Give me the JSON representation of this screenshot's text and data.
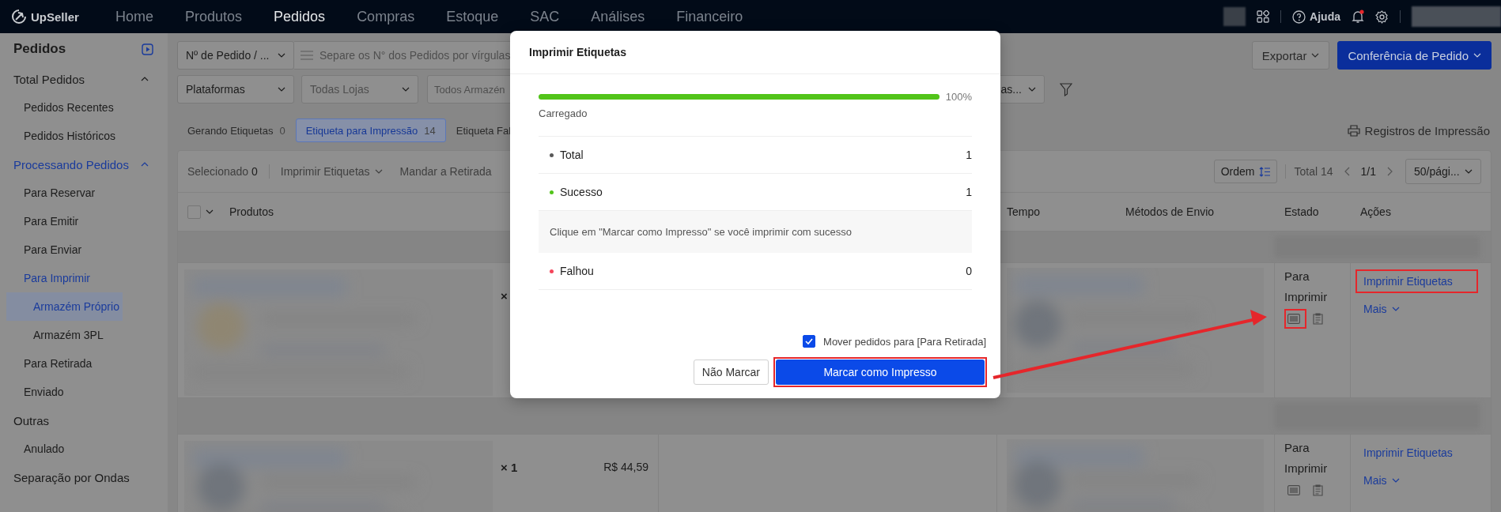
{
  "top_nav": {
    "logo": "UpSeller",
    "items": [
      {
        "label": "Home",
        "selected": false
      },
      {
        "label": "Produtos",
        "selected": false
      },
      {
        "label": "Pedidos",
        "selected": true
      },
      {
        "label": "Compras",
        "selected": false
      },
      {
        "label": "Estoque",
        "selected": false
      },
      {
        "label": "SAC",
        "selected": false
      },
      {
        "label": "Análises",
        "selected": false
      },
      {
        "label": "Financeiro",
        "selected": false
      }
    ],
    "help": "Ajuda",
    "notification_dot": true
  },
  "sidebar": {
    "title": "Pedidos",
    "items": [
      {
        "label": "Total Pedidos",
        "selected": false,
        "expanded": true,
        "children": [
          {
            "label": "Pedidos Recentes",
            "selected": false
          },
          {
            "label": "Pedidos Históricos",
            "selected": false
          }
        ]
      },
      {
        "label": "Processando Pedidos",
        "selected": false,
        "expanded": true,
        "children": [
          {
            "label": "Para Reservar",
            "selected": false
          },
          {
            "label": "Para Emitir",
            "selected": false
          },
          {
            "label": "Para Enviar",
            "selected": false
          },
          {
            "label": "Para Imprimir",
            "selected": false,
            "children": [
              {
                "label": "Armazém Próprio",
                "selected": true
              },
              {
                "label": "Armazém 3PL",
                "selected": false
              }
            ]
          },
          {
            "label": "Para Retirada",
            "selected": false
          },
          {
            "label": "Enviado",
            "selected": false
          }
        ]
      },
      {
        "label": "Outras",
        "selected": false,
        "children": [
          {
            "label": "Anulado",
            "selected": false
          }
        ]
      },
      {
        "label": "Separação por Ondas",
        "selected": false
      }
    ]
  },
  "filters": {
    "search_type": "Nº de Pedido / ...",
    "search_placeholder": "Separe os N° dos Pedidos por vírgulas",
    "selects": [
      {
        "value": "Plataformas"
      },
      {
        "placeholder": "Todas Lojas"
      },
      {
        "placeholder": "Todos Armazén"
      },
      {
        "value": "as..."
      }
    ]
  },
  "header_actions": {
    "export": "Exportar",
    "order_check": "Conferência de Pedido"
  },
  "status_tabs": [
    {
      "label": "Gerando Etiquetas",
      "count": "0",
      "selected": false
    },
    {
      "label": "Etiqueta para Impressão",
      "count": "14",
      "selected": true
    },
    {
      "label": "Etiqueta Fal",
      "selected": false
    }
  ],
  "print_log": "Registros de Impressão",
  "toolbar": {
    "selected_label": "Selecionado",
    "selected_count": "0",
    "print_labels": "Imprimir Etiquetas",
    "send_pickup": "Mandar a Retirada",
    "order": "Ordem",
    "total": "Total 14",
    "page": "1/1",
    "page_size": "50/pági..."
  },
  "table": {
    "select_all_checked": false,
    "columns": [
      "Produtos",
      "Tempo",
      "Métodos de Envio",
      "Estado",
      "Ações"
    ],
    "rows": [
      {
        "quantity": "×",
        "status": "Para Imprimir",
        "action": "Imprimir Etiquetas",
        "more": "Mais",
        "action_highlighted": true,
        "icon_highlighted": true
      },
      {
        "quantity": "× 1",
        "price": "R$ 44,59",
        "status": "Para Imprimir",
        "action": "Imprimir Etiquetas",
        "more": "Mais",
        "action_highlighted": false,
        "icon_highlighted": false
      }
    ]
  },
  "dialog": {
    "title": "Imprimir Etiquetas",
    "progress": {
      "level": 1,
      "reading": "100%",
      "caption": "Carregado"
    },
    "results": [
      {
        "kind": "count",
        "label": "Total",
        "value": "1",
        "color": "#595959"
      },
      {
        "kind": "count",
        "label": "Sucesso",
        "value": "1",
        "color": "#52c41a"
      },
      {
        "kind": "note",
        "text": "Clique em \"Marcar como Impresso\" se você imprimir com sucesso"
      },
      {
        "kind": "count",
        "label": "Falhou",
        "value": "0",
        "color": "#f5455b"
      }
    ],
    "move_option": {
      "label": "Mover pedidos para [Para Retirada]",
      "checked": true
    },
    "buttons": [
      {
        "label": "Não Marcar",
        "kind": "secondary",
        "highlighted": false
      },
      {
        "label": "Marcar como Impresso",
        "kind": "primary",
        "highlighted": true
      }
    ]
  },
  "annotation": {
    "arrow": true
  }
}
